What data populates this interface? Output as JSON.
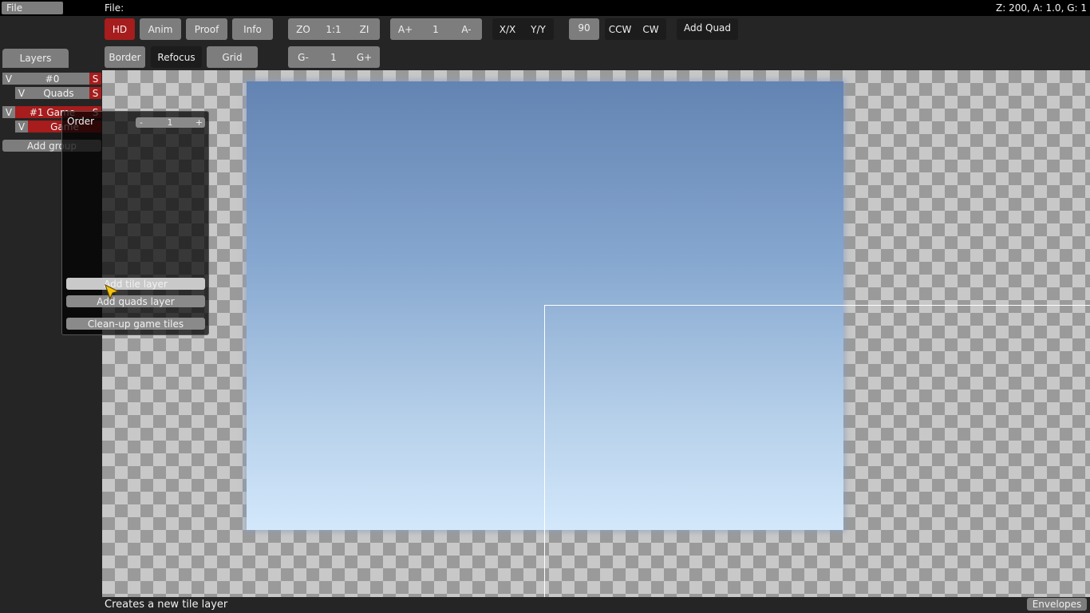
{
  "menubar": {
    "file_menu": "File",
    "file_label": "File:",
    "zoom_info": "Z: 200, A: 1.0, G: 1"
  },
  "toolbar": {
    "row1": {
      "hd": "HD",
      "anim": "Anim",
      "proof": "Proof",
      "info": "Info",
      "zoom_out": "ZO",
      "zoom_reset": "1:1",
      "zoom_in": "ZI",
      "anim_faster": "A+",
      "anim_speed": "1",
      "anim_slower": "A-",
      "flip_x": "X/X",
      "flip_y": "Y/Y",
      "rotation": "90",
      "rotate_ccw": "CCW",
      "rotate_cw": "CW",
      "add_quad": "Add Quad"
    },
    "row2": {
      "border": "Border",
      "refocus": "Refocus",
      "grid": "Grid",
      "grid_less": "G-",
      "grid_factor": "1",
      "grid_more": "G+"
    }
  },
  "layers_panel": {
    "tab": "Layers",
    "rows": [
      {
        "visible": "V",
        "name": "#0",
        "solo": "S"
      },
      {
        "visible": "V",
        "name": "Quads",
        "solo": "S"
      },
      {
        "visible": "V",
        "name": "#1 Game",
        "solo": "S"
      },
      {
        "visible": "V",
        "name": "Game",
        "solo": ""
      }
    ],
    "add_group": "Add group"
  },
  "popup": {
    "order_label": "Order",
    "order_minus": "-",
    "order_value": "1",
    "order_plus": "+",
    "add_tile_layer": "Add tile layer",
    "add_quads_layer": "Add quads layer",
    "cleanup_game_tiles": "Clean-up game tiles"
  },
  "statusbar": {
    "tooltip": "Creates a new tile layer",
    "envelopes": "Envelopes"
  },
  "colors": {
    "active_red": "#a71c1c",
    "button_gray": "#7d7d7d",
    "cursor_yellow": "#f4c20d"
  }
}
